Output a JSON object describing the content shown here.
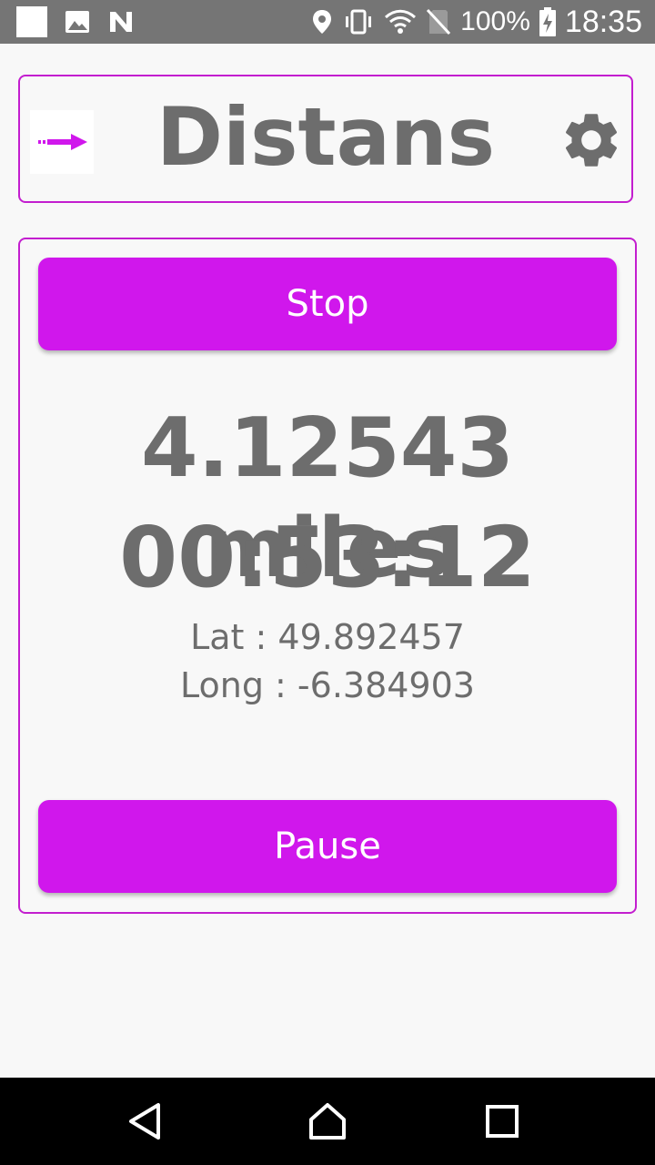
{
  "status_bar": {
    "battery": "100%",
    "time": "18:35",
    "icons": [
      "square-notification-icon",
      "image-icon",
      "n-icon",
      "location-icon",
      "vibrate-icon",
      "wifi-icon",
      "no-sim-icon",
      "battery-charging-icon"
    ]
  },
  "header": {
    "title": "Distans",
    "menu_icon": "arrow-logo-icon",
    "settings_icon": "gear-icon"
  },
  "tracker": {
    "stop_label": "Stop",
    "distance": "4.12543 miles",
    "elapsed": "00:53:12",
    "lat": "Lat : 49.892457",
    "long": "Long : -6.384903",
    "pause_label": "Pause"
  },
  "colors": {
    "accent": "#d017ec",
    "border": "#c31ecf",
    "text": "#6d6d6d",
    "status_bar": "#757575"
  },
  "nav": {
    "icons": [
      "back-icon",
      "home-icon",
      "recents-icon"
    ]
  }
}
